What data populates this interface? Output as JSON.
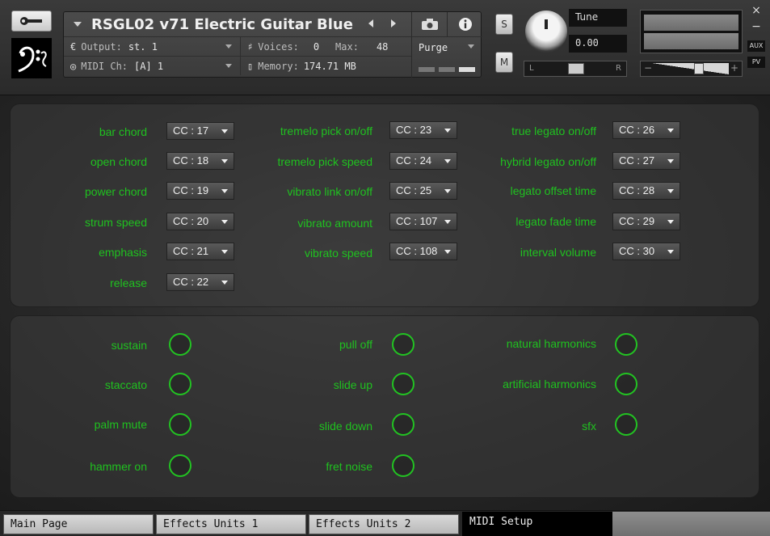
{
  "header": {
    "title": "RSGL02 v71 Electric Guitar Blue",
    "output_label": "Output:",
    "output_value": "st. 1",
    "voices_label": "Voices:",
    "voices_value": "0",
    "max_label": "Max:",
    "max_value": "48",
    "midi_label": "MIDI Ch:",
    "midi_value": "[A]  1",
    "memory_label": "Memory:",
    "memory_value": "174.71 MB",
    "purge_label": "Purge",
    "solo_label": "S",
    "mute_label": "M",
    "tune_label": "Tune",
    "tune_value": "0.00",
    "pan_left": "L",
    "pan_right": "R",
    "vol_minus": "−",
    "vol_plus": "+",
    "aux_label": "AUX",
    "pv_label": "PV",
    "close_label": "×",
    "minimize_label": "−"
  },
  "cc_controls": [
    {
      "label": "bar chord",
      "value": "CC : 17"
    },
    {
      "label": "open chord",
      "value": "CC : 18"
    },
    {
      "label": "power chord",
      "value": "CC : 19"
    },
    {
      "label": "strum speed",
      "value": "CC : 20"
    },
    {
      "label": "emphasis",
      "value": "CC : 21"
    },
    {
      "label": "release",
      "value": "CC : 22"
    },
    {
      "label": "tremelo pick on/off",
      "value": "CC : 23"
    },
    {
      "label": "tremelo pick speed",
      "value": "CC : 24"
    },
    {
      "label": "vibrato link on/off",
      "value": "CC : 25"
    },
    {
      "label": "vibrato amount",
      "value": "CC : 107"
    },
    {
      "label": "vibrato speed",
      "value": "CC : 108"
    },
    {
      "label": "true legato on/off",
      "value": "CC : 26"
    },
    {
      "label": "hybrid legato on/off",
      "value": "CC : 27"
    },
    {
      "label": "legato offset time",
      "value": "CC : 28"
    },
    {
      "label": "legato fade time",
      "value": "CC : 29"
    },
    {
      "label": "interval volume",
      "value": "CC : 30"
    }
  ],
  "articulations": [
    {
      "label": "sustain"
    },
    {
      "label": "staccato"
    },
    {
      "label": "palm mute"
    },
    {
      "label": "hammer on"
    },
    {
      "label": "pull off"
    },
    {
      "label": "slide up"
    },
    {
      "label": "slide down"
    },
    {
      "label": "fret noise"
    },
    {
      "label": "natural harmonics"
    },
    {
      "label": "artificial harmonics"
    },
    {
      "label": "sfx"
    }
  ],
  "tabs": [
    {
      "label": "Main Page"
    },
    {
      "label": "Effects Units 1"
    },
    {
      "label": "Effects Units 2"
    },
    {
      "label": "MIDI Setup"
    }
  ],
  "colors": {
    "accent_green": "#1fc21f"
  }
}
